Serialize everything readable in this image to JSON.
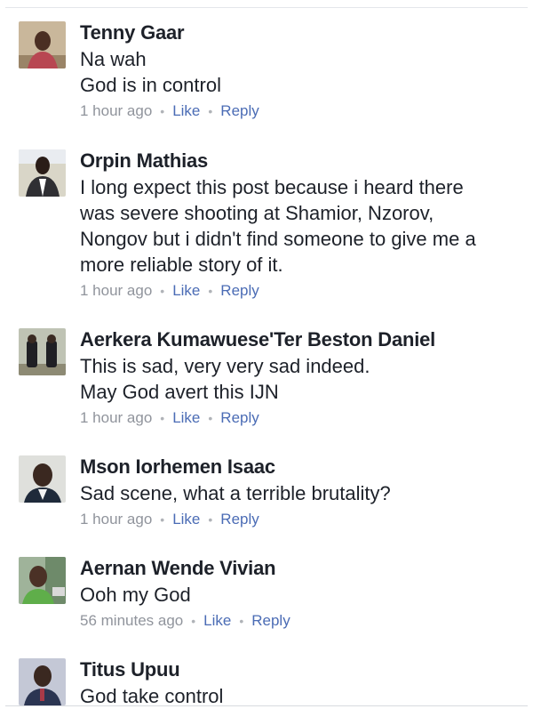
{
  "comments": [
    {
      "name": "Tenny Gaar",
      "lines": [
        "Na wah",
        "God is in control"
      ],
      "time": "1 hour ago",
      "like": "Like",
      "reply": "Reply"
    },
    {
      "name": "Orpin Mathias",
      "lines": [
        "I long expect this post because i heard there",
        "was severe shooting at Shamior, Nzorov,",
        "Nongov but i didn't find someone to give me a",
        "more reliable story of it."
      ],
      "time": "1 hour ago",
      "like": "Like",
      "reply": "Reply"
    },
    {
      "name": "Aerkera Kumawuese'Ter Beston Daniel",
      "lines": [
        "This is sad, very very sad indeed.",
        "May God avert this IJN"
      ],
      "time": "1 hour ago",
      "like": "Like",
      "reply": "Reply"
    },
    {
      "name": "Mson Iorhemen Isaac",
      "lines": [
        "Sad scene, what a terrible brutality?"
      ],
      "time": "1 hour ago",
      "like": "Like",
      "reply": "Reply"
    },
    {
      "name": "Aernan Wende Vivian",
      "lines": [
        "Ooh my God"
      ],
      "time": "56 minutes ago",
      "like": "Like",
      "reply": "Reply"
    },
    {
      "name": "Titus Upuu",
      "lines": [
        "God take control"
      ]
    }
  ],
  "meta_separator": "•"
}
